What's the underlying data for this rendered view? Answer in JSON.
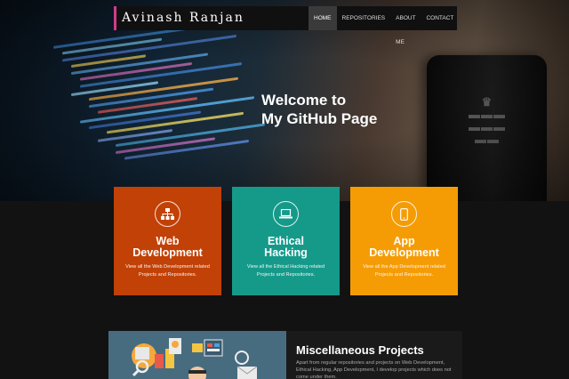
{
  "brand": {
    "name": "Avinash Ranjan",
    "accent": "#d23c8c"
  },
  "nav": {
    "items": [
      {
        "label": "HOME",
        "active": true
      },
      {
        "label": "REPOSITORIES",
        "active": false
      },
      {
        "label": "ABOUT ME",
        "active": false
      },
      {
        "label": "CONTACT",
        "active": false
      }
    ]
  },
  "hero": {
    "line1": "Welcome to",
    "line2": "My GitHub Page"
  },
  "cards": [
    {
      "title_line1": "Web",
      "title_line2": "Development",
      "description": "View all the Web Development related Projects and Repositories.",
      "color": "#c24107",
      "icon": "sitemap-icon"
    },
    {
      "title_line1": "Ethical",
      "title_line2": "Hacking",
      "description": "View all the Ethical Hacking related Projects and Repositories.",
      "color": "#159a8a",
      "icon": "laptop-icon"
    },
    {
      "title_line1": "App",
      "title_line2": "Development",
      "description": "View all the App Development related Projects and Repositories.",
      "color": "#f59c05",
      "icon": "mobile-icon"
    }
  ],
  "misc": {
    "title": "Miscellaneous Projects",
    "text": "Apart from regular repositories and projects on Web Development, Ethical Hacking, App Development, I develop projects which does not come under them."
  }
}
